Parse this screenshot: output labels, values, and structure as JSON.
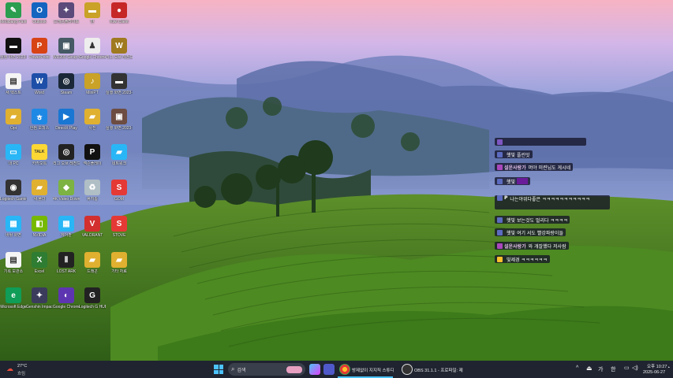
{
  "desktop": {
    "icons": [
      {
        "label": "Medibang Paint",
        "color": "#2a9d4f",
        "glyph": "✎"
      },
      {
        "label": "Outlook",
        "color": "#1565c0",
        "glyph": "O"
      },
      {
        "label": "드래곤플라이트",
        "color": "#5b4a7a",
        "glyph": "✦"
      },
      {
        "label": "반",
        "color": "#c9a227",
        "glyph": "▬"
      },
      {
        "label": "Kiwi Client",
        "color": "#c62828",
        "glyph": "●"
      },
      {
        "label": "실행 화면 2023-05-...",
        "color": "#111",
        "glyph": "▬"
      },
      {
        "label": "PowerPoint",
        "color": "#d84315",
        "glyph": "P"
      },
      {
        "label": "WD200 Setup v29",
        "color": "#455a64",
        "glyph": "▣"
      },
      {
        "label": "Google Chrome 게임",
        "color": "#eeeeee",
        "glyph": "♟"
      },
      {
        "label": "리그 오브 레전드",
        "color": "#a07a20",
        "glyph": "W"
      },
      {
        "label": "새 텍스트",
        "color": "#f5f5f5",
        "glyph": "▤"
      },
      {
        "label": "Word",
        "color": "#1e4fa8",
        "glyph": "W"
      },
      {
        "label": "Steam",
        "color": "#1b2838",
        "glyph": "◎"
      },
      {
        "label": "MiniPT",
        "color": "#c9a227",
        "glyph": "♪"
      },
      {
        "label": "실행 화면 2023-05-...",
        "color": "#333",
        "glyph": "▬"
      },
      {
        "label": "Opt",
        "color": "#e0b030",
        "glyph": "▰"
      },
      {
        "label": "한컴 오피스",
        "color": "#1e88e5",
        "glyph": "ㅎ"
      },
      {
        "label": "DirectX Play",
        "color": "#1976d2",
        "glyph": "▶"
      },
      {
        "label": "사진",
        "color": "#e0b030",
        "glyph": "▰"
      },
      {
        "label": "실행 화면 2023-05-...",
        "color": "#6d4c41",
        "glyph": "▣"
      },
      {
        "label": "내 PC",
        "color": "#29b6f6",
        "glyph": "▭"
      },
      {
        "label": "카카오톡",
        "color": "#fdd835",
        "glyph": "TALK"
      },
      {
        "label": "리그 오브 레전드 제...",
        "color": "#222",
        "glyph": "◎"
      },
      {
        "label": "넥슨플레이",
        "color": "#111",
        "glyph": "P"
      },
      {
        "label": "네트워크",
        "color": "#29b6f6",
        "glyph": "▰"
      },
      {
        "label": "Logitech Gaming",
        "color": "#333",
        "glyph": "◉"
      },
      {
        "label": "새 폴더",
        "color": "#e0b030",
        "glyph": "▰"
      },
      {
        "label": "4K Video Downloader",
        "color": "#7cb342",
        "glyph": "◆"
      },
      {
        "label": "휴지통",
        "color": "#b0bec5",
        "glyph": "♻"
      },
      {
        "label": "GOM",
        "color": "#e53935",
        "glyph": "S"
      },
      {
        "label": "바탕 화면",
        "color": "#29b6f6",
        "glyph": "▦"
      },
      {
        "label": "NVIDIA",
        "color": "#76b900",
        "glyph": "◧"
      },
      {
        "label": "제어판",
        "color": "#29b6f6",
        "glyph": "▦"
      },
      {
        "label": "VALORANT",
        "color": "#d32f2f",
        "glyph": "V"
      },
      {
        "label": "STOVE",
        "color": "#e53935",
        "glyph": "S"
      },
      {
        "label": "기록 보관소",
        "color": "#f5f5f5",
        "glyph": "▤"
      },
      {
        "label": "Excel",
        "color": "#2e7d32",
        "glyph": "X"
      },
      {
        "label": "LOST ARK",
        "color": "#222",
        "glyph": "Ⅱ"
      },
      {
        "label": "드래곤",
        "color": "#e0b030",
        "glyph": "▰"
      },
      {
        "label": "기타 자료",
        "color": "#e0b030",
        "glyph": "▰"
      },
      {
        "label": "Microsoft Edge",
        "color": "#0f9d58",
        "glyph": "e"
      },
      {
        "label": "Genshin Impact",
        "color": "#3b3b5c",
        "glyph": "✦"
      },
      {
        "label": "Google Chrome",
        "color": "#5e35b1",
        "glyph": "◐"
      },
      {
        "label": "Logitech G HUB",
        "color": "#222",
        "glyph": "G"
      }
    ]
  },
  "chat": {
    "messages": [
      {
        "nick": "",
        "text": "",
        "badge": "#7e57c2"
      },
      {
        "nick": "",
        "text": "햇빛 플린잇",
        "badge": "#5c6bc0"
      },
      {
        "nick": "설운사랑가",
        "text": "머야 미련님도 게시네",
        "badge": "#ab47bc"
      },
      {
        "nick": "",
        "text": "햇빛 ",
        "badge": "#5c6bc0"
      },
      {
        "nick": "P",
        "text": "나는야위다좋은 ㅋㅋㅋㅋㅋㅋㅋㅋㅋㅋㅋ",
        "badge": "#5c6bc0"
      },
      {
        "nick": "",
        "text": "햇빛 보는것도 멀리다 ㅋㅋㅋㅋ",
        "badge": "#5c6bc0"
      },
      {
        "nick": "",
        "text": "햇빛 여기 서도 빨강파랑이들",
        "badge": "#5c6bc0"
      },
      {
        "nick": "설운사랑가",
        "text": "와 개잘했다 저사람",
        "badge": "#ab47bc"
      },
      {
        "nick": "",
        "text": "빛제경 ㅋㅋㅋㅋㅋㅋ",
        "badge": "#fbc02d"
      }
    ]
  },
  "taskbar": {
    "weather_temp": "27°C",
    "weather_desc": "흐림",
    "search_placeholder": "검색",
    "apps": [
      {
        "label": "방제없이 지지직 스튜디",
        "color": "#e53935"
      },
      {
        "label": "OBS 31.1.1 - 프로파일: 제",
        "color": "#333"
      }
    ],
    "tray_ime1": "가",
    "tray_ime2": "한",
    "time": "오후 10:27",
    "date": "2025-06-27"
  }
}
